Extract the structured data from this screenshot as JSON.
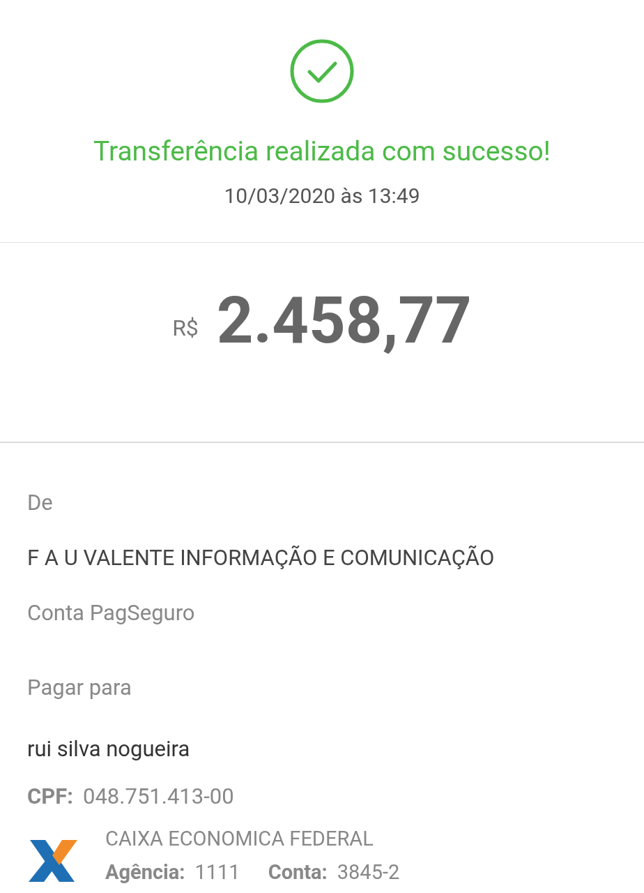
{
  "header": {
    "title": "Transferência realizada com sucesso!",
    "datetime": "10/03/2020 às 13:49"
  },
  "amount": {
    "currency": "R$",
    "value": "2.458,77"
  },
  "from": {
    "label": "De",
    "name": "F A U VALENTE INFORMAÇÃO E COMUNICAÇÃO",
    "account": "Conta PagSeguro"
  },
  "to": {
    "label": "Pagar para",
    "name": "rui silva nogueira",
    "cpf_label": "CPF:",
    "cpf": "048.751.413-00",
    "bank": {
      "name": "CAIXA ECONOMICA FEDERAL",
      "agency_label": "Agência:",
      "agency": "1111",
      "account_label": "Conta:",
      "account": "3845-2"
    }
  }
}
